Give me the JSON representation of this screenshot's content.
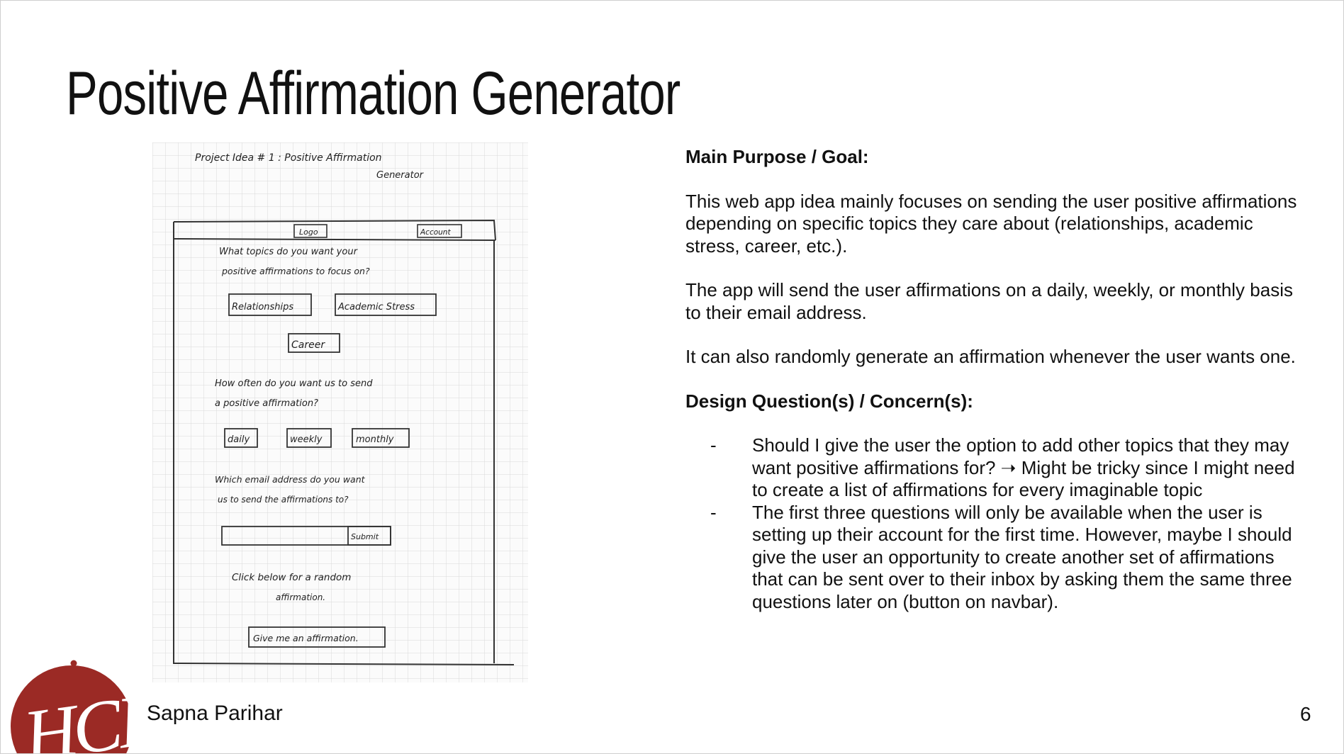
{
  "slide": {
    "title": "Positive Affirmation Generator",
    "author": "Sapna Parihar",
    "page_number": "6",
    "logo_text": "HCII",
    "logo_color": "#9b2a25"
  },
  "sketch": {
    "heading_line1": "Project Idea # 1 : Positive Affirmation",
    "heading_line2": "Generator",
    "logo_box": "Logo",
    "account_box": "Account",
    "q1_line1": "What topics do you want your",
    "q1_line2": "positive affirmations to focus on?",
    "topic_relationships": "Relationships",
    "topic_academic": "Academic Stress",
    "topic_career": "Career",
    "q2_line1": "How often do you want us to send",
    "q2_line2": "a positive affirmation?",
    "freq_daily": "daily",
    "freq_weekly": "weekly",
    "freq_monthly": "monthly",
    "q3_line1": "Which email address do you want",
    "q3_line2": "us to send the affirmations to?",
    "submit": "Submit",
    "random_line1": "Click below for a random",
    "random_line2": "affirmation.",
    "give_button": "Give me an affirmation."
  },
  "content": {
    "purpose_heading": "Main Purpose / Goal:",
    "para1": "This web app idea mainly focuses on sending the user positive affirmations depending on specific topics they care about (relationships, academic stress, career, etc.).",
    "para2": "The app will send the user affirmations on a daily, weekly, or monthly basis to their email address.",
    "para3": "It can also randomly generate an affirmation whenever the user wants one.",
    "concerns_heading": "Design Question(s) / Concern(s):",
    "bullets": [
      {
        "dash": "-",
        "text": "Should I give the user the option to add other topics that they may want positive affirmations for? ➝ Might be tricky since I might need to create a list of affirmations for every imaginable topic"
      },
      {
        "dash": "-",
        "text": "The first three questions will only be available when the user is setting up their account for the first time. However, maybe I should give the user an opportunity to create another set of affirmations that can be sent over to their inbox by asking them the same three questions later on (button on navbar)."
      }
    ]
  }
}
